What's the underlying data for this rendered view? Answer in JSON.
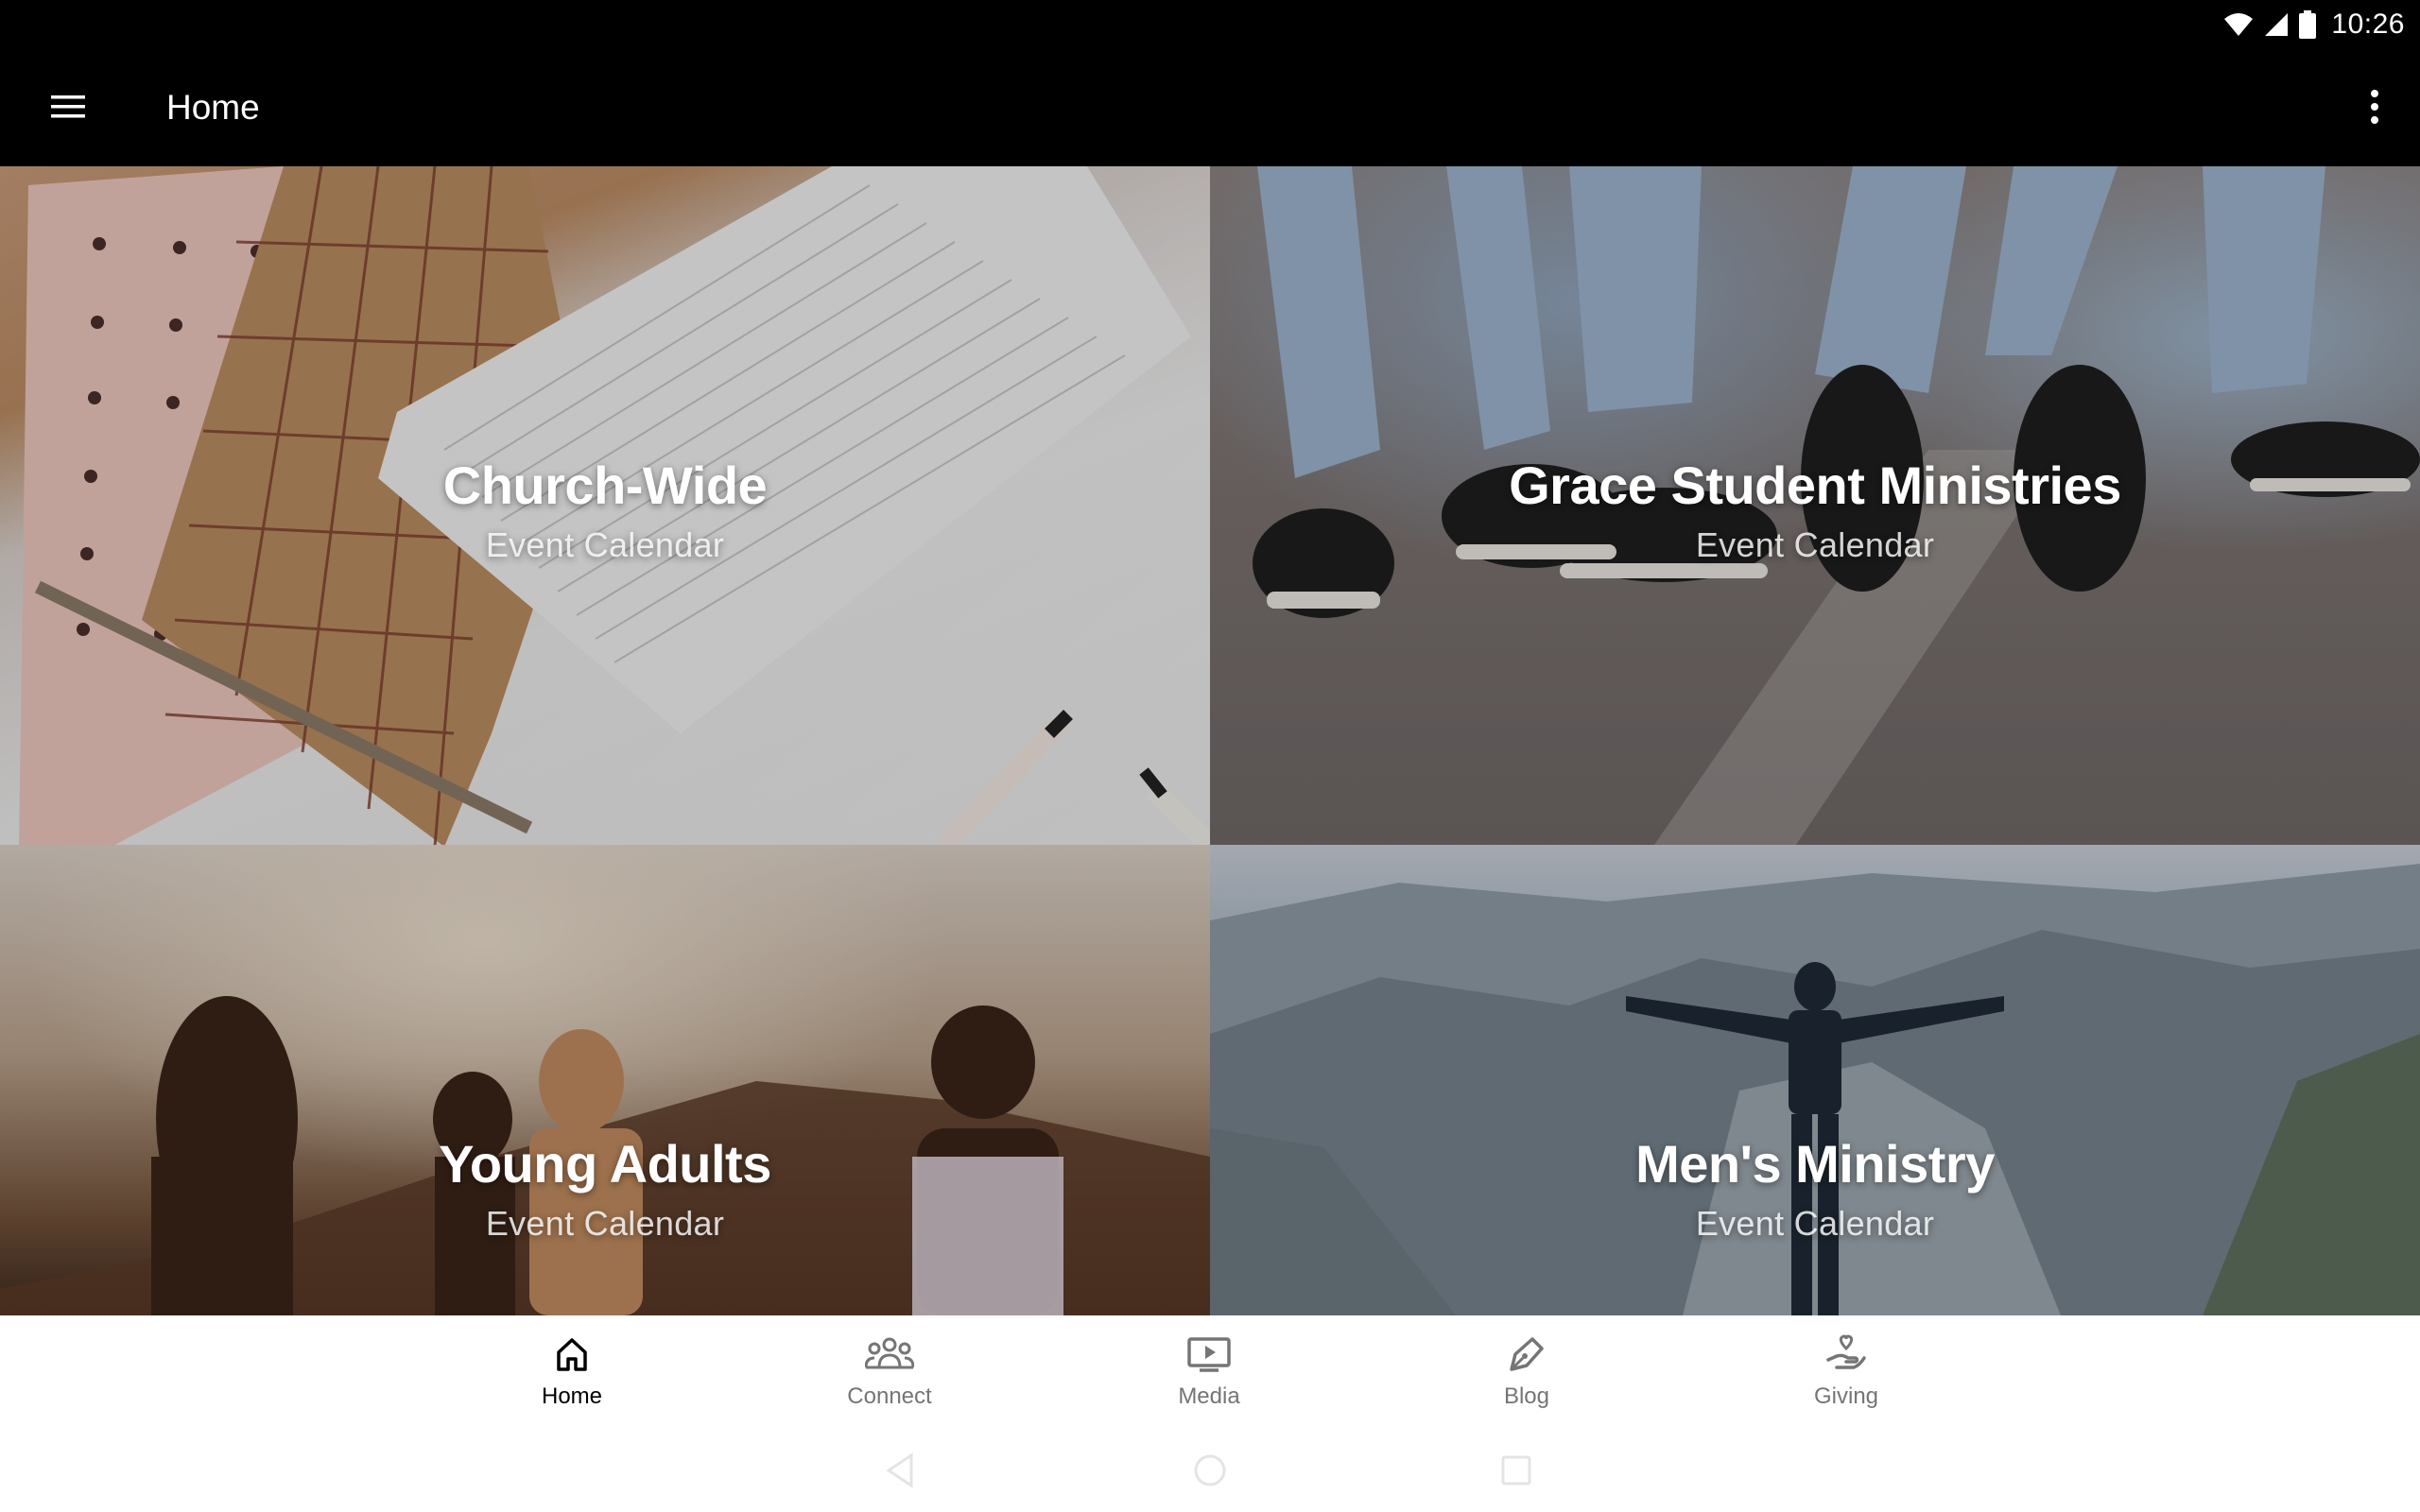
{
  "status_bar": {
    "time": "10:26",
    "icons": [
      "wifi-icon",
      "signal-icon",
      "battery-icon"
    ]
  },
  "app_bar": {
    "title": "Home",
    "menu_icon": "hamburger-menu-icon",
    "overflow_icon": "more-vert-icon"
  },
  "tiles": [
    {
      "title": "Church-Wide",
      "subtitle": "Event Calendar"
    },
    {
      "title": "Grace Student Ministries",
      "subtitle": "Event Calendar"
    },
    {
      "title": "Young Adults",
      "subtitle": "Event Calendar"
    },
    {
      "title": "Men's Ministry",
      "subtitle": "Event Calendar"
    }
  ],
  "bottom_nav": {
    "items": [
      {
        "label": "Home",
        "icon": "home-icon",
        "active": true
      },
      {
        "label": "Connect",
        "icon": "people-icon",
        "active": false
      },
      {
        "label": "Media",
        "icon": "play-screen-icon",
        "active": false
      },
      {
        "label": "Blog",
        "icon": "pen-icon",
        "active": false
      },
      {
        "label": "Giving",
        "icon": "giving-hand-icon",
        "active": false
      }
    ]
  },
  "system_nav": {
    "buttons": [
      "back-icon",
      "home-circle-icon",
      "recents-icon"
    ]
  },
  "colors": {
    "bar_background": "#000000",
    "active_nav": "#000000",
    "inactive_nav": "#757575"
  }
}
